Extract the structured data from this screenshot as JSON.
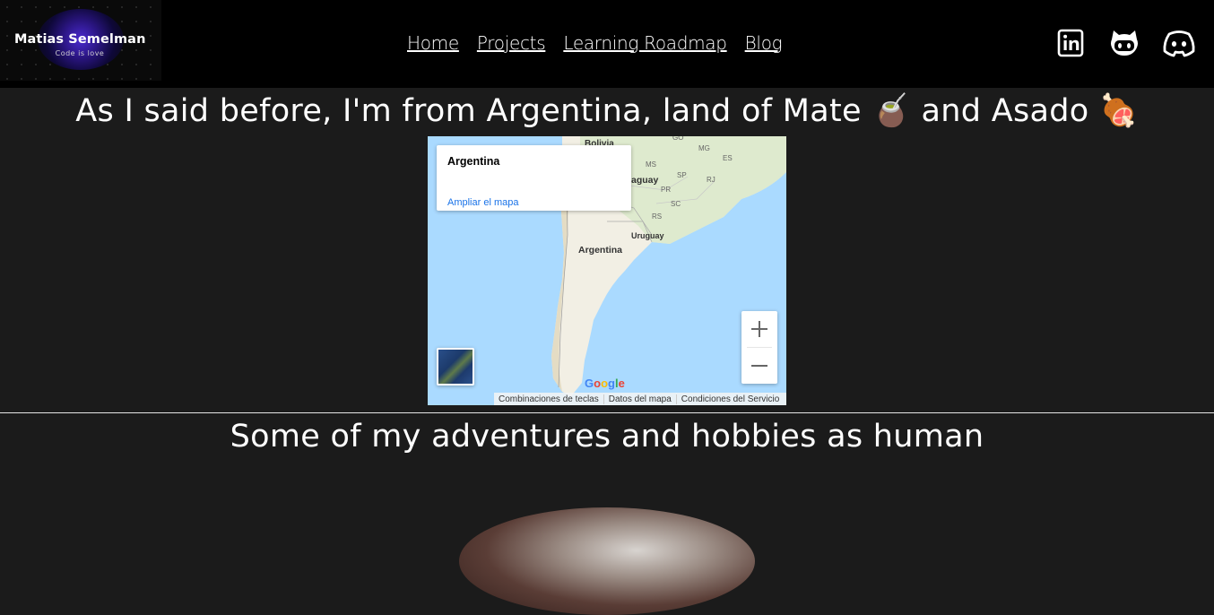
{
  "header": {
    "logo": {
      "name": "Matias Semelman",
      "tagline": "Code is love"
    },
    "nav": [
      {
        "label": "Home"
      },
      {
        "label": "Projects"
      },
      {
        "label": "Learning Roadmap"
      },
      {
        "label": "Blog"
      }
    ],
    "social": [
      {
        "icon": "linkedin-icon"
      },
      {
        "icon": "github-icon"
      },
      {
        "icon": "discord-icon"
      }
    ]
  },
  "section_argentina": {
    "title": "As I said before, I'm from Argentina, land of Mate 🧉 and Asado 🍖"
  },
  "map": {
    "info_title": "Argentina",
    "info_link": "Ampliar el mapa",
    "labels": {
      "bolivia": "Bolivia",
      "paraguay": "aguay",
      "argentina": "Argentina",
      "uruguay": "Uruguay",
      "go": "GO",
      "mg": "MG",
      "es": "ES",
      "ms": "MS",
      "sp": "SP",
      "rj": "RJ",
      "pr": "PR",
      "sc": "SC",
      "rs": "RS"
    },
    "zoom_in": "+",
    "zoom_out": "−",
    "google": "Google",
    "attribution": [
      "Combinaciones de teclas",
      "Datos del mapa",
      "Condiciones del Servicio"
    ],
    "colors": {
      "water": "#aadaff",
      "land": "#f2efe4",
      "link": "#1a73e8"
    }
  },
  "section_adventures": {
    "title": "Some of my adventures and hobbies as human"
  }
}
